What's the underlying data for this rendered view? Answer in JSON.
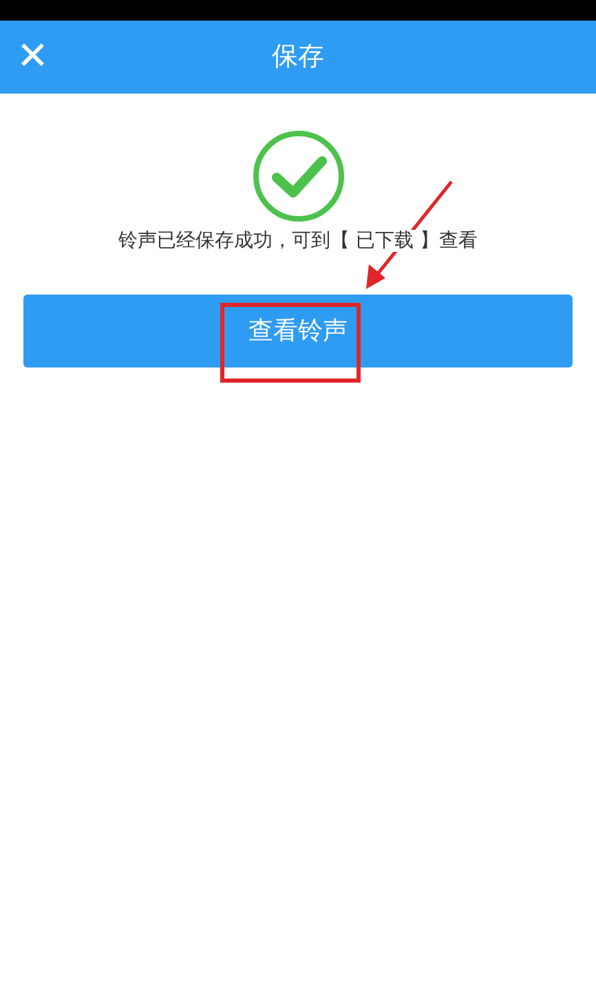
{
  "header": {
    "close_icon": "✕",
    "title": "保存"
  },
  "message": "铃声已经保存成功，可到【 已下载 】查看",
  "button": {
    "label": "查看铃声"
  }
}
